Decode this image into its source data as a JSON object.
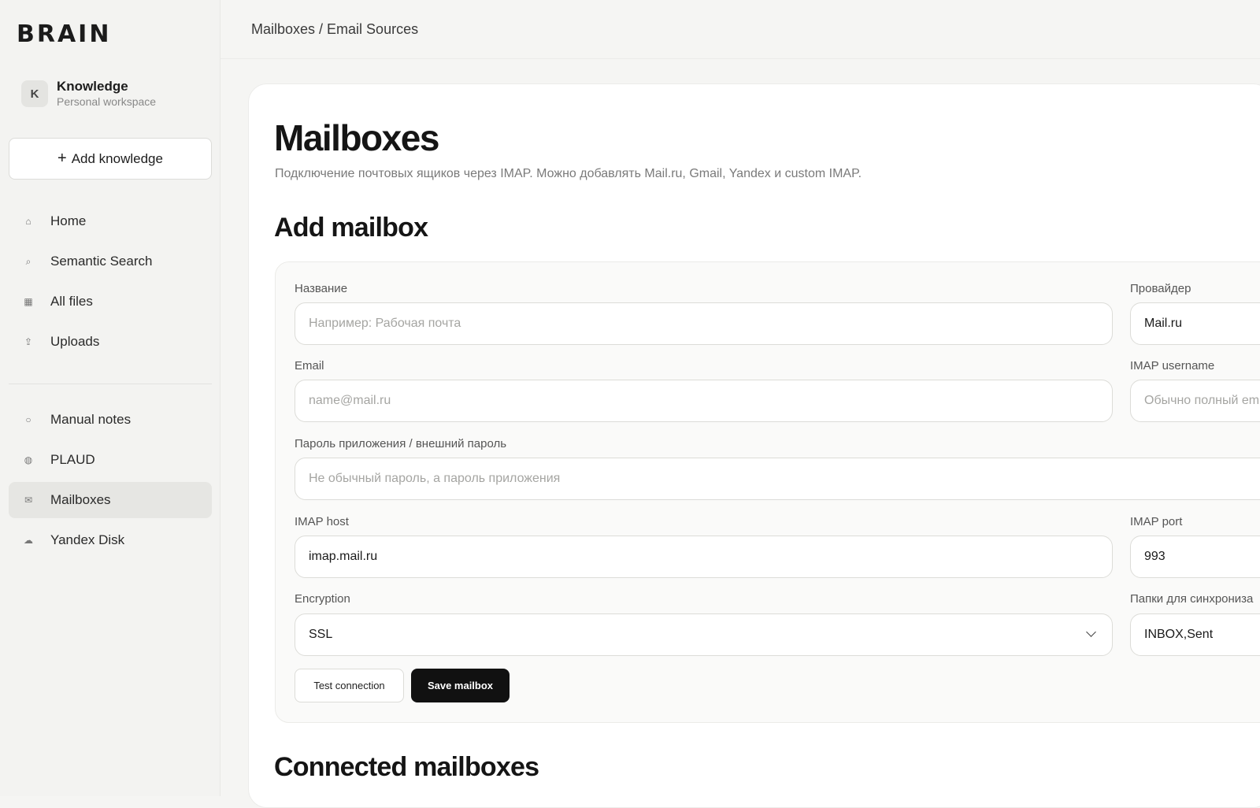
{
  "brand": "BRAIN",
  "workspace": {
    "avatar_letter": "K",
    "name": "Knowledge",
    "subtitle": "Personal workspace"
  },
  "sidebar": {
    "add_button": {
      "icon": "+",
      "label": "Add knowledge"
    },
    "items": [
      {
        "icon": "⌂",
        "icon_name": "home-icon",
        "label": "Home"
      },
      {
        "icon": "⌕",
        "icon_name": "search-icon",
        "label": "Semantic Search"
      },
      {
        "icon": "▦",
        "icon_name": "grid-icon",
        "label": "All files"
      },
      {
        "icon": "⇪",
        "icon_name": "upload-icon",
        "label": "Uploads"
      },
      {
        "icon": "○",
        "icon_name": "circle-icon",
        "label": "Manual notes"
      },
      {
        "icon": "◍",
        "icon_name": "dot-circle-icon",
        "label": "PLAUD"
      },
      {
        "icon": "✉",
        "icon_name": "mail-icon",
        "label": "Mailboxes",
        "active": true
      },
      {
        "icon": "☁",
        "icon_name": "cloud-icon",
        "label": "Yandex Disk"
      }
    ]
  },
  "topbar": {
    "breadcrumb": "Mailboxes / Email Sources"
  },
  "page": {
    "title": "Mailboxes",
    "subtitle": "Подключение почтовых ящиков через IMAP. Можно добавлять Mail.ru, Gmail, Yandex и custom IMAP."
  },
  "add_mailbox": {
    "title": "Add mailbox",
    "fields": {
      "name": {
        "label": "Название",
        "placeholder": "Например: Рабочая почта"
      },
      "provider": {
        "label": "Провайдер",
        "value": "Mail.ru"
      },
      "email": {
        "label": "Email",
        "placeholder": "name@mail.ru"
      },
      "imap_username": {
        "label": "IMAP username",
        "placeholder": "Обычно полный em"
      },
      "password": {
        "label": "Пароль приложения / внешний пароль",
        "placeholder": "Не обычный пароль, а пароль приложения"
      },
      "imap_host": {
        "label": "IMAP host",
        "value": "imap.mail.ru"
      },
      "imap_port": {
        "label": "IMAP port",
        "value": "993"
      },
      "encryption": {
        "label": "Encryption",
        "value": "SSL"
      },
      "folders": {
        "label": "Папки для синхрониза",
        "value": "INBOX,Sent"
      }
    },
    "buttons": {
      "test": "Test connection",
      "save": "Save mailbox"
    }
  },
  "connected": {
    "title": "Connected mailboxes"
  },
  "colors": {
    "primary_button": "#111111",
    "active_nav": "#e6e6e3",
    "background": "#f5f5f3"
  }
}
